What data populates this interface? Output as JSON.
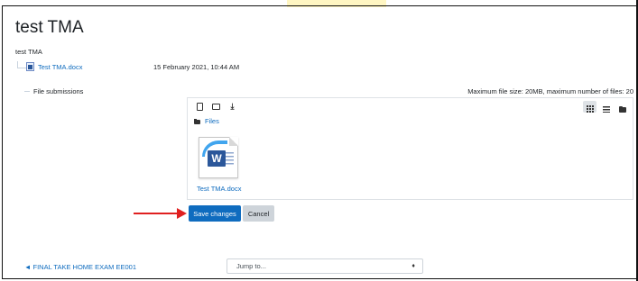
{
  "page": {
    "title": "test TMA",
    "intro": "test TMA"
  },
  "submission_file": {
    "name": "Test TMA.docx",
    "date": "15 February 2021, 10:44 AM"
  },
  "file_submissions": {
    "label": "File submissions",
    "max_info": "Maximum file size: 20MB, maximum number of files: 20",
    "toolbar": {
      "add_icon": "file-icon",
      "create_folder_icon": "folder-icon",
      "download_icon": "download-icon",
      "views": [
        "grid-view-icon",
        "list-view-icon",
        "tree-view-icon"
      ],
      "active_view": "grid-view-icon"
    },
    "path": "Files",
    "files": [
      {
        "name": "Test TMA.docx",
        "icon": "word-document-icon"
      }
    ]
  },
  "actions": {
    "save_label": "Save changes",
    "cancel_label": "Cancel"
  },
  "annotation": {
    "arrow_color": "#e02020"
  },
  "footer": {
    "prev_link": "◄ FINAL TAKE HOME EXAM EE001",
    "jump_placeholder": "Jump to...",
    "jump_caret": "♦"
  },
  "colors": {
    "link": "#0f6cbf",
    "primary_button": "#0f6cbf",
    "secondary_button": "#ced4da",
    "word_blue": "#2b579a"
  }
}
